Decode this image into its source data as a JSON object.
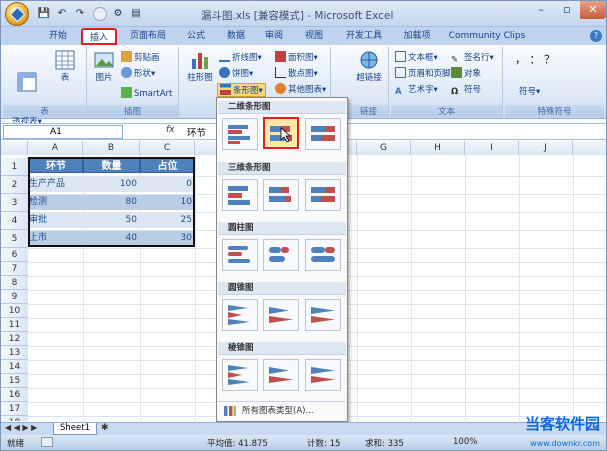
{
  "titlebar": {
    "title": "漏斗图.xls [兼容模式] - Microsoft Excel",
    "qat_save": "💾",
    "qat_undo": "↶",
    "qat_redo": "↷"
  },
  "window_controls": {
    "minimize": "–",
    "restore": "▫",
    "close": "✕"
  },
  "tabs": [
    {
      "label": "开始"
    },
    {
      "label": "插入"
    },
    {
      "label": "页面布局"
    },
    {
      "label": "公式"
    },
    {
      "label": "数据"
    },
    {
      "label": "审阅"
    },
    {
      "label": "视图"
    },
    {
      "label": "开发工具"
    },
    {
      "label": "加载项"
    },
    {
      "label": "Community Clips"
    }
  ],
  "help_label": "?",
  "ribbon": {
    "tables_group": {
      "pivot": "数据\n透视表▾",
      "table": "表",
      "label": "表"
    },
    "illustrations_group": {
      "picture": "图片",
      "clipart": "剪贴画",
      "shapes": "形状▾",
      "smartart": "SmartArt",
      "label": "插图"
    },
    "charts_group": {
      "column": "柱形图",
      "line": "折线图▾",
      "pie": "饼图▾",
      "bar": "条形图▾",
      "area": "面积图▾",
      "scatter": "散点图▾",
      "other": "其他图表▾"
    },
    "links_group": {
      "hyperlink": "超链接",
      "label": "链接"
    },
    "text_group": {
      "textbox": "文本框▾",
      "header": "页眉和页脚",
      "wordart": "艺术字▾",
      "signature": "签名行▾",
      "object": "对象",
      "symbol": "符号",
      "label": "文本"
    },
    "special_group": {
      "row1": "，  ：  ？",
      "symbol": "符号▾",
      "label": "特殊符号"
    }
  },
  "formula_bar": {
    "name": "A1",
    "fx": "fx",
    "content": "环节"
  },
  "columns": [
    "A",
    "B",
    "C",
    "D",
    "E",
    "F",
    "G",
    "H",
    "I",
    "J"
  ],
  "rows": [
    "1",
    "2",
    "3",
    "4",
    "5",
    "6",
    "7",
    "8",
    "9",
    "10",
    "11",
    "12",
    "13",
    "14",
    "15",
    "16",
    "17",
    "18",
    "19"
  ],
  "table": {
    "headers": [
      "环节",
      "数量",
      "占位"
    ],
    "rows": [
      {
        "name": "生产产品",
        "qty": "100",
        "pad": "0"
      },
      {
        "name": "检测",
        "qty": "80",
        "pad": "10"
      },
      {
        "name": "审批",
        "qty": "50",
        "pad": "25"
      },
      {
        "name": "上市",
        "qty": "40",
        "pad": "30"
      }
    ]
  },
  "dropdown": {
    "sections": [
      "二维条形图",
      "三维条形图",
      "圆柱图",
      "圆锥图",
      "棱锥图"
    ],
    "all_types": "所有图表类型(A)..."
  },
  "sheet_tab": "Sheet1",
  "status": {
    "ready": "就绪",
    "avg": "平均值: 41.875",
    "count": "计数: 15",
    "sum": "求和: 335",
    "zoom": "100%"
  },
  "watermark": {
    "brand": "当客软件园",
    "url": "www.downkr.com"
  },
  "colors": {
    "table_header": "#4f81bd",
    "row_light": "#dce6f2",
    "highlight": "#e02020"
  }
}
